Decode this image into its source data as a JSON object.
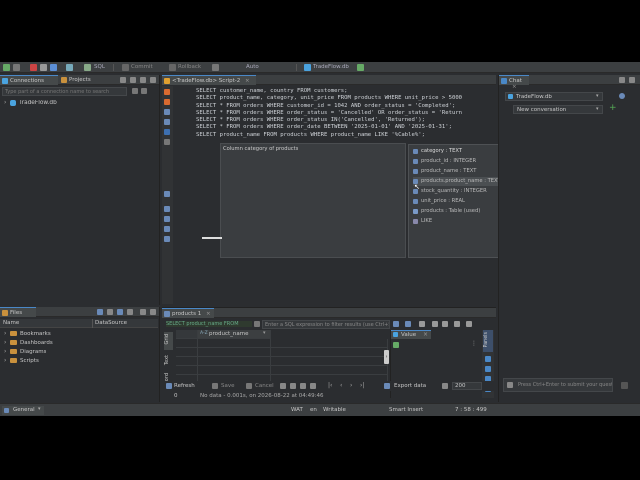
{
  "toolbar": {
    "sql_label": "SQL",
    "commit_label": "Commit",
    "rollback_label": "Rollback",
    "tx_mode_label": "Auto",
    "datasource_label": "TradeFlow.db"
  },
  "left_panel": {
    "tabs": [
      "Connections",
      "Projects"
    ],
    "search_placeholder": "Type part of a connection name to search",
    "tree": [
      {
        "label": "TradeFlow.db"
      }
    ]
  },
  "editor": {
    "tab_label": "<TradeFlow.db> Script-2",
    "sql_lines": [
      "SELECT customer_name, country FROM customers;",
      "SELECT product_name, category, unit_price FROM products WHERE unit_price > 5000",
      "SELECT * FROM orders WHERE customer_id = 1042 AND order_status = 'Completed';",
      "SELECT * FROM orders WHERE order_status = 'Cancelled' OR order_status = 'Return",
      "SELECT * FROM orders WHERE order_status IN('Cancelled', 'Returned');",
      "SELECT * FROM orders WHERE order_date BETWEEN '2025-01-01' AND '2025-01-31';",
      "SELECT product_name FROM products WHERE product_name LIKE '%Cable%';"
    ],
    "tooltip": "Column category of products"
  },
  "autocomplete": {
    "items": [
      {
        "label": "category : TEXT"
      },
      {
        "label": "product_id : INTEGER"
      },
      {
        "label": "product_name : TEXT"
      },
      {
        "label": "products.product_name : TEXT"
      },
      {
        "label": "stock_quantity : INTEGER"
      },
      {
        "label": "unit_price : REAL"
      },
      {
        "label": "products : Table (used)"
      },
      {
        "label": "LIKE"
      }
    ],
    "selected_index": 3
  },
  "results": {
    "tab_label": "products 1",
    "query_preview": "SELECT product_name FROM",
    "filter_placeholder": "Enter a SQL expression to filter results (use Ctrl+Space)",
    "side_tabs": [
      "Grid",
      "Text",
      "Record"
    ],
    "column_header": "product_name",
    "column_type_badge": "A-Z",
    "refresh_label": "Refresh",
    "save_label": "Save",
    "cancel_label": "Cancel",
    "export_label": "Export data",
    "limit_value": "200",
    "row_count": "0",
    "status_text": "No data - 0.001s, on 2026-08-22 at 04:49:46"
  },
  "value_panel": {
    "tab_label": "Value"
  },
  "panels_tab": "Panels",
  "files": {
    "tab_label": "Files",
    "columns": [
      "Name",
      "DataSource"
    ],
    "items": [
      {
        "label": "Bookmarks"
      },
      {
        "label": "Dashboards"
      },
      {
        "label": "Diagrams"
      },
      {
        "label": "Scripts"
      }
    ]
  },
  "chat": {
    "tab_label": "Chat",
    "datasource_select": "TradeFlow.db",
    "conversation_select": "New conversation",
    "input_placeholder": "Press Ctrl+Enter to submit your question"
  },
  "status": {
    "format": "General",
    "timezone": "WAT",
    "locale": "en",
    "mode": "Writable",
    "insert_mode": "Smart Insert",
    "cursor_pos": "7 : 58 : 499"
  },
  "colors": {
    "accent": "#4a88c7",
    "keyword": "#cfd3d8",
    "string_literal": "#e6db74",
    "folder": "#c9913d",
    "db": "#4aa3df"
  }
}
